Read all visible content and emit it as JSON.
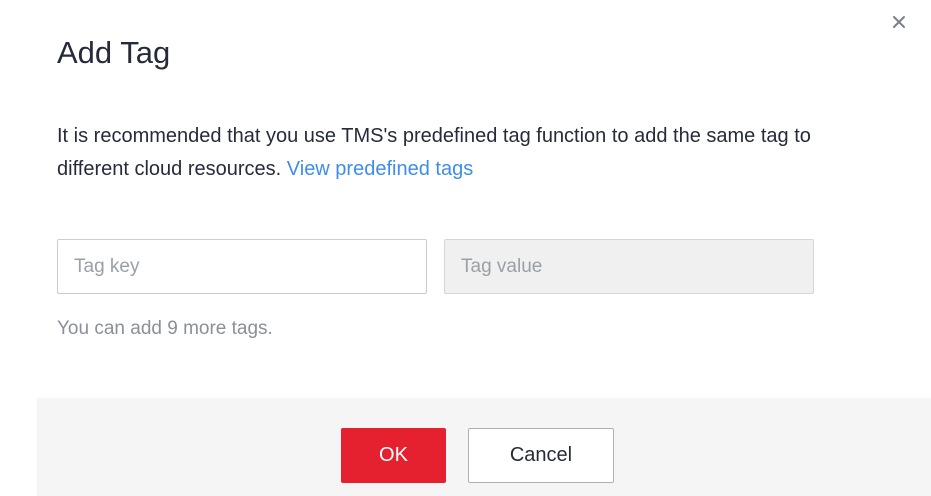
{
  "dialog": {
    "title": "Add Tag",
    "description_text": "It is recommended that you use TMS's predefined tag function to add the same tag to different cloud resources. ",
    "description_link": "View predefined tags",
    "tag_key": {
      "placeholder": "Tag key",
      "value": ""
    },
    "tag_value": {
      "placeholder": "Tag value",
      "value": ""
    },
    "hint": "You can add 9 more tags.",
    "ok_label": "OK",
    "cancel_label": "Cancel",
    "close_icon": "close-icon"
  },
  "colors": {
    "accent_red": "#e5202f",
    "link_blue": "#3d8eea",
    "footer_bg": "#f5f5f5",
    "disabled_input_bg": "#f0f0f0"
  }
}
